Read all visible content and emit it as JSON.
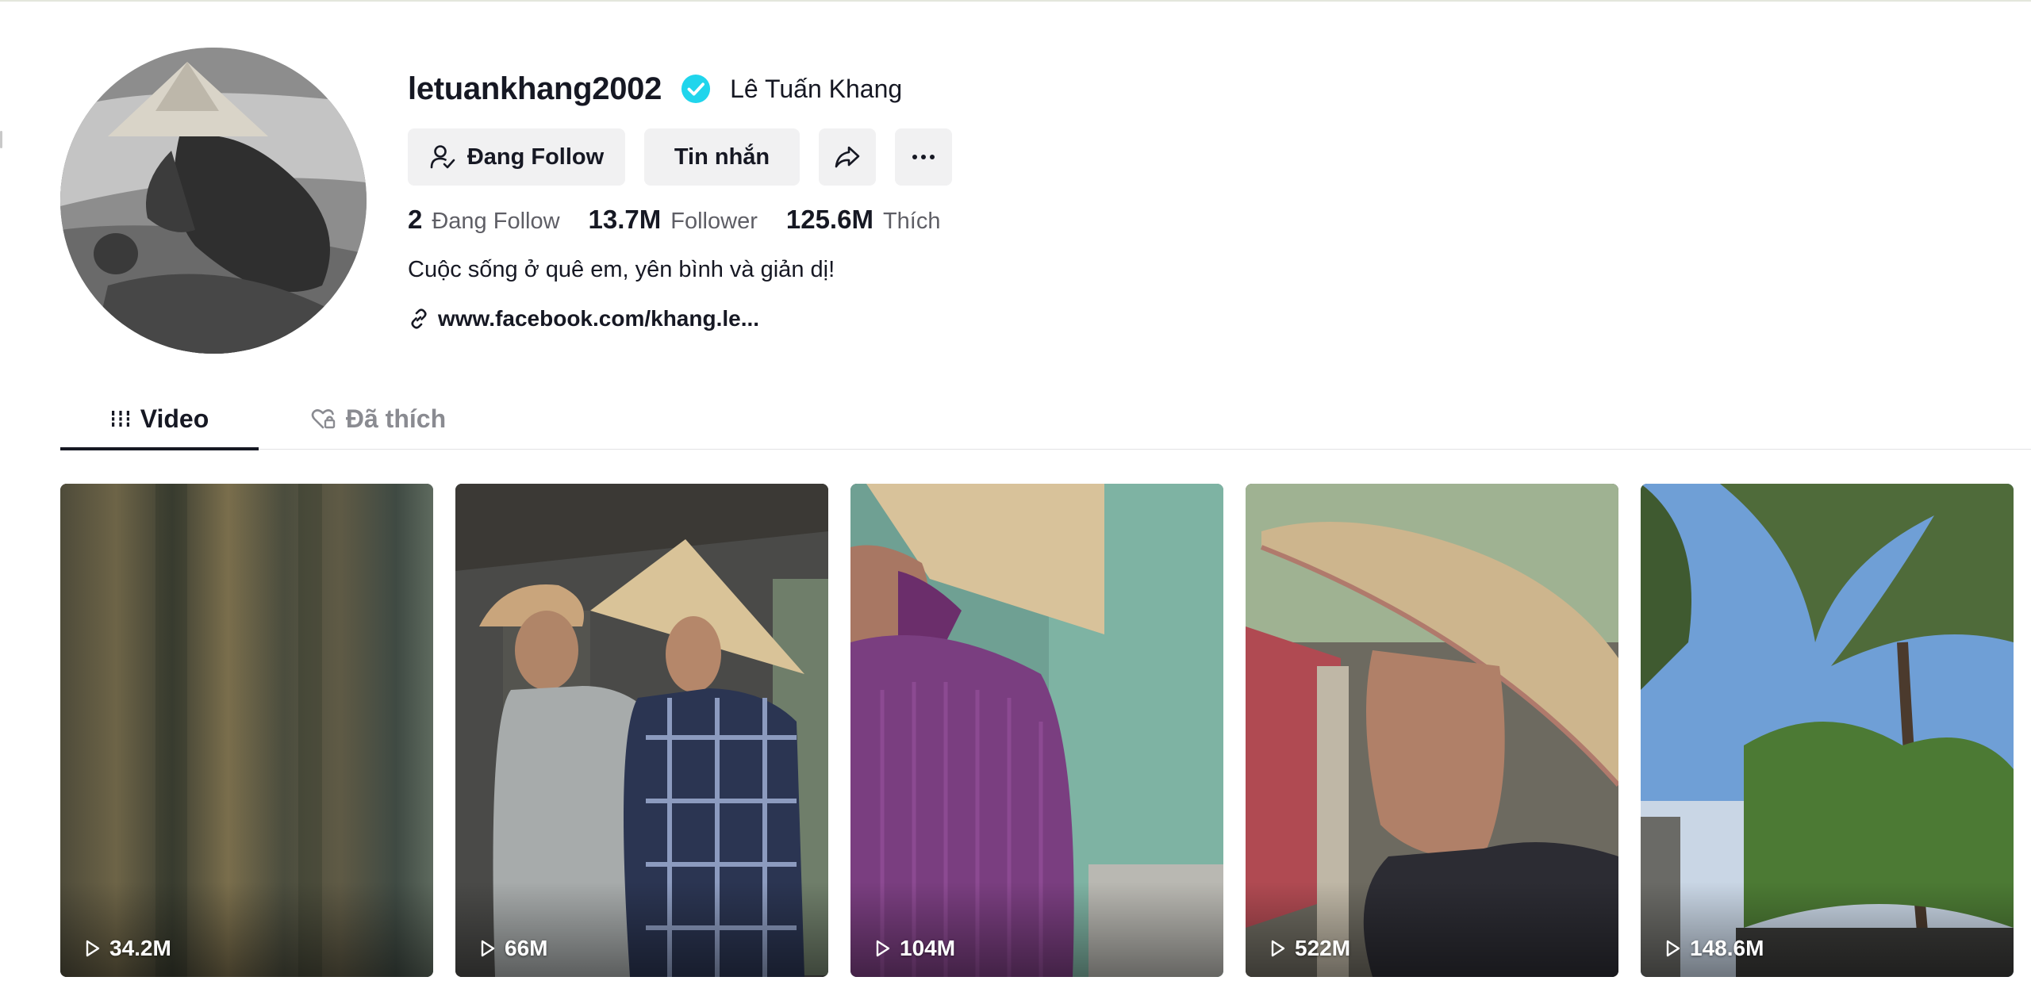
{
  "profile": {
    "username": "letuankhang2002",
    "nickname": "Lê Tuấn Khang",
    "bio": "Cuộc sống ở quê em, yên bình và giản dị!",
    "link": "www.facebook.com/khang.le..."
  },
  "actions": {
    "following_label": "Đang Follow",
    "message_label": "Tin nhắn"
  },
  "stats": [
    {
      "value": "2",
      "label": "Đang Follow"
    },
    {
      "value": "13.7M",
      "label": "Follower"
    },
    {
      "value": "125.6M",
      "label": "Thích"
    }
  ],
  "tabs": [
    {
      "label": "Video",
      "icon": "grid-lines-icon",
      "active": true
    },
    {
      "label": "Đã thích",
      "icon": "heart-lock-icon",
      "active": false
    }
  ],
  "videos": [
    {
      "views": "34.2M"
    },
    {
      "views": "66M"
    },
    {
      "views": "104M"
    },
    {
      "views": "522M"
    },
    {
      "views": "148.6M"
    }
  ],
  "colors": {
    "verified": "#20d5ec",
    "text": "#161823",
    "secondary_text": "#5e5e65",
    "button_bg": "#f1f1f2",
    "inactive_tab": "#8a8b91"
  }
}
